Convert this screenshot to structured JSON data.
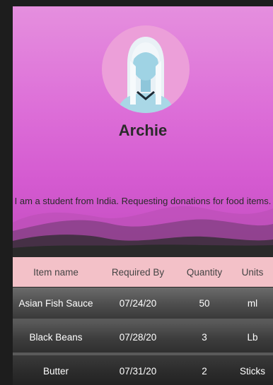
{
  "profile": {
    "name": "Archie",
    "bio": "I am a student from India. Requesting donations for food items."
  },
  "table": {
    "headers": [
      "Item name",
      "Required By",
      "Quantity",
      "Units"
    ],
    "rows": [
      [
        "Asian Fish Sauce",
        "07/24/20",
        "50",
        "ml"
      ],
      [
        "Black Beans",
        "07/28/20",
        "3",
        "Lb"
      ],
      [
        "Butter",
        "07/31/20",
        "2",
        "Sticks"
      ]
    ]
  },
  "colors": {
    "hero_gradient_top": "#e58fde",
    "hero_gradient_bottom": "#c24dbf",
    "table_header_bg": "#f3c1c8",
    "row_text": "#ffffff"
  },
  "icons": {
    "avatar": "avatar-illustration"
  }
}
